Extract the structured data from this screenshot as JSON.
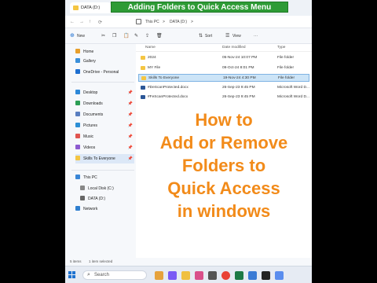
{
  "banner": "Adding Folders to Quick Access Menu",
  "tab": {
    "title": "DATA (D:)"
  },
  "address": {
    "back": "←",
    "forward": "→",
    "up": "↑",
    "refresh": "⟳",
    "path": [
      "This PC",
      ">",
      "DATA (D:)",
      ">"
    ]
  },
  "cmdbar": {
    "new": "New",
    "sort": "Sort",
    "view": "View",
    "more": "···"
  },
  "sidebar": {
    "items": [
      {
        "label": "Home",
        "color": "#e89f2b"
      },
      {
        "label": "Gallery",
        "color": "#3a8fd9"
      },
      {
        "label": "OneDrive - Personal",
        "color": "#1e6fd0"
      },
      {
        "label": "Desktop",
        "color": "#2e88d8"
      },
      {
        "label": "Downloads",
        "color": "#2c9e54"
      },
      {
        "label": "Documents",
        "color": "#5a7fc0"
      },
      {
        "label": "Pictures",
        "color": "#2d8fd5"
      },
      {
        "label": "Music",
        "color": "#e0554f"
      },
      {
        "label": "Videos",
        "color": "#8d5bd0"
      },
      {
        "label": "Skills To Everyone",
        "color": "#f4c542"
      },
      {
        "label": "This PC",
        "color": "#3a86d6"
      },
      {
        "label": "Local Disk (C:)",
        "color": "#888888"
      },
      {
        "label": "DATA (D:)",
        "color": "#666666"
      },
      {
        "label": "Network",
        "color": "#2f7fcf"
      }
    ]
  },
  "table": {
    "headers": [
      "Name",
      "Date modified",
      "Type"
    ],
    "rows": [
      {
        "name": "2024",
        "date": "05-Nov-24 10:07 PM",
        "type": "File folder",
        "color": "#f4c542"
      },
      {
        "name": "MY File",
        "date": "09-Oct-24 8:01 PM",
        "type": "File folder",
        "color": "#f4c542"
      },
      {
        "name": "Skills To Everyone",
        "date": "19-Nov-24 4:30 PM",
        "type": "File folder",
        "color": "#f4c542"
      },
      {
        "name": "#DeScanProtected.docx",
        "date": "26-Sep-23 9:45 PM",
        "type": "Microsoft Word D...",
        "color": "#2b5797"
      },
      {
        "name": "#FeScanProtected.docx",
        "date": "26-Sep-23 9:45 PM",
        "type": "Microsoft Word D...",
        "color": "#2b5797"
      }
    ]
  },
  "overlay_lines": [
    "How to",
    "Add or Remove",
    "Folders to",
    "Quick Access",
    "in windows"
  ],
  "status": {
    "items": "5 items",
    "selected": "1 item selected"
  },
  "taskbar": {
    "search_placeholder": "Search"
  }
}
